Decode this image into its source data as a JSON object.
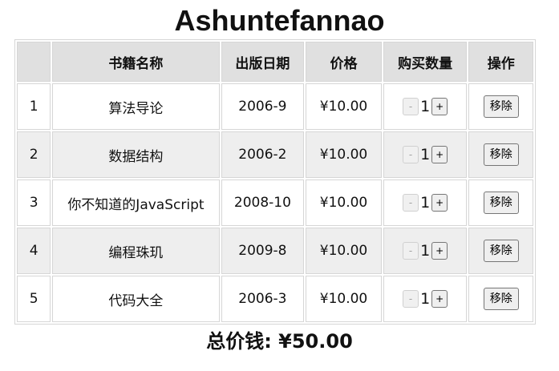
{
  "page": {
    "title": "Ashuntefannao"
  },
  "table": {
    "headers": [
      "",
      "书籍名称",
      "出版日期",
      "价格",
      "购买数量",
      "操作"
    ],
    "rows": [
      {
        "id": "1",
        "name": "算法导论",
        "date": "2006-9",
        "price": "¥10.00",
        "count": "1",
        "remove_label": "移除"
      },
      {
        "id": "2",
        "name": "数据结构",
        "date": "2006-2",
        "price": "¥10.00",
        "count": "1",
        "remove_label": "移除"
      },
      {
        "id": "3",
        "name": "你不知道的JavaScript",
        "date": "2008-10",
        "price": "¥10.00",
        "count": "1",
        "remove_label": "移除"
      },
      {
        "id": "4",
        "name": "编程珠玑",
        "date": "2009-8",
        "price": "¥10.00",
        "count": "1",
        "remove_label": "移除"
      },
      {
        "id": "5",
        "name": "代码大全",
        "date": "2006-3",
        "price": "¥10.00",
        "count": "1",
        "remove_label": "移除"
      }
    ],
    "decrement_label": "-",
    "increment_label": "+"
  },
  "summary": {
    "total_text": "总价钱: ¥50.00"
  }
}
